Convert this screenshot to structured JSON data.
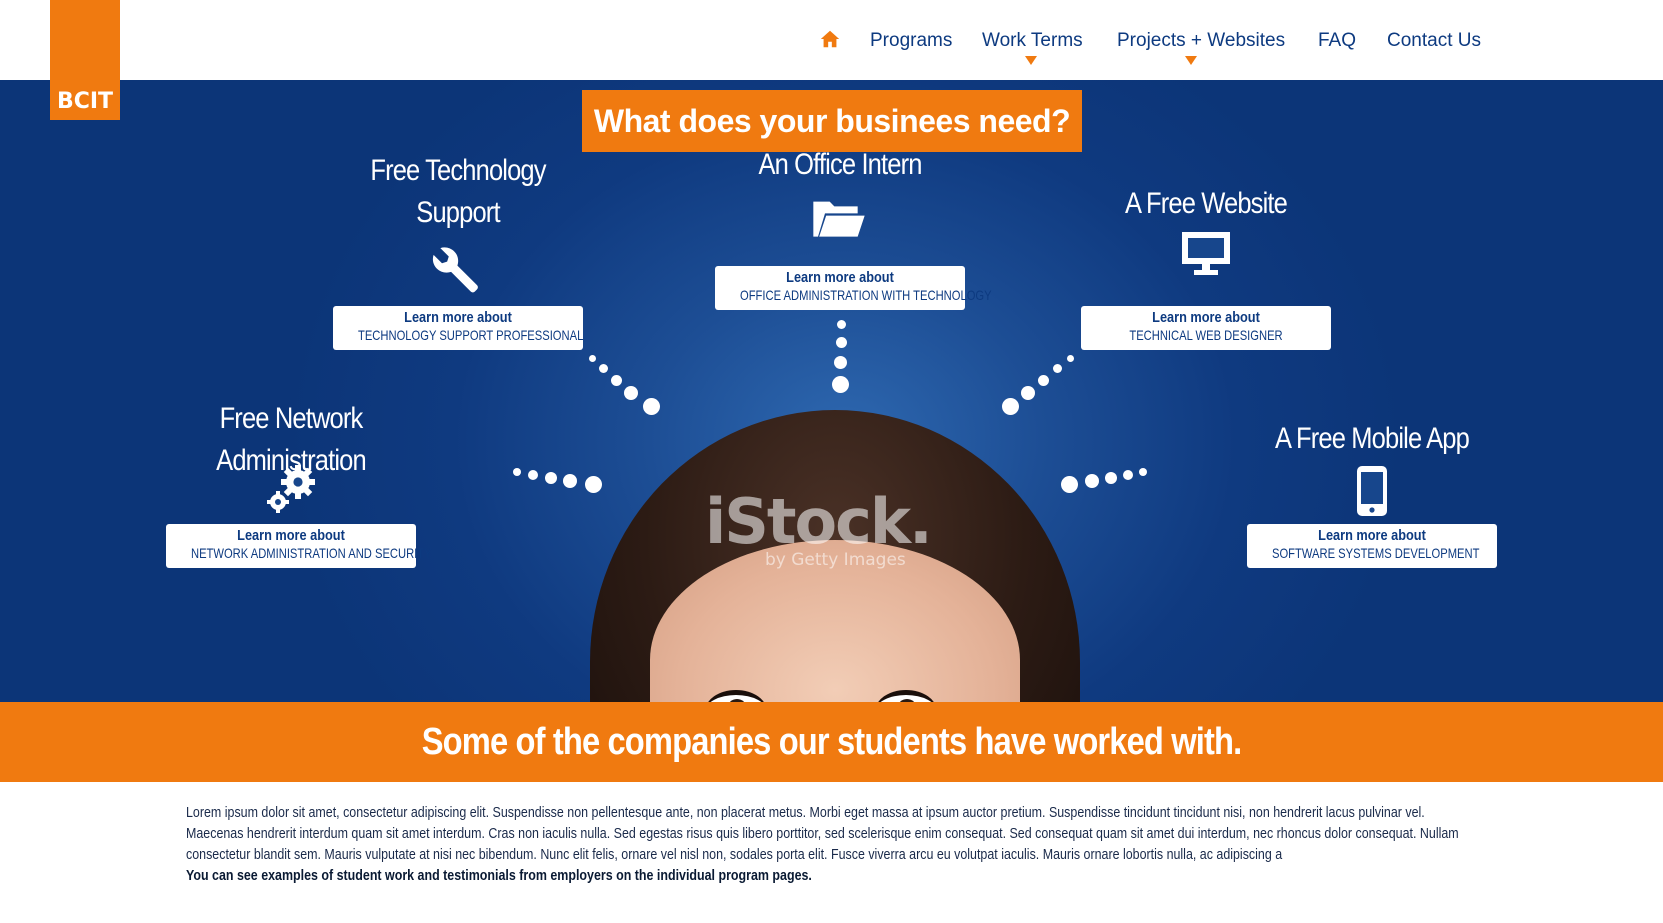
{
  "logo": {
    "text": "BCIT"
  },
  "nav": {
    "home_icon": "home-icon",
    "items": [
      "Programs",
      "Work Terms",
      "Projects + Websites",
      "FAQ",
      "Contact Us"
    ]
  },
  "hero": {
    "title": "What does your businees need?",
    "services": [
      {
        "title": "Free Technology Support",
        "icon": "wrench-icon",
        "btn_l1": "Learn more about",
        "btn_l2": "TECHNOLOGY SUPPORT PROFESSIONAL"
      },
      {
        "title": "An Office Intern",
        "icon": "folder-icon",
        "btn_l1": "Learn more about",
        "btn_l2": "OFFICE ADMINISTRATION WITH TECHNOLOGY"
      },
      {
        "title": "A Free Website",
        "icon": "monitor-icon",
        "btn_l1": "Learn more about",
        "btn_l2": "TECHNICAL WEB DESIGNER"
      },
      {
        "title": "Free Network Administration",
        "icon": "gears-icon",
        "btn_l1": "Learn more about",
        "btn_l2": "NETWORK ADMINISTRATION AND SECURITY"
      },
      {
        "title": "A Free Mobile App",
        "icon": "smartphone-icon",
        "btn_l1": "Learn more about",
        "btn_l2": "SOFTWARE SYSTEMS DEVELOPMENT"
      }
    ],
    "watermark": "iStock.",
    "watermark_sub": "by Getty Images"
  },
  "band": {
    "text": "Some of the companies our students have worked with."
  },
  "body": {
    "lorem": "Lorem ipsum dolor sit amet, consectetur adipiscing elit. Suspendisse non pellentesque ante, non placerat metus. Morbi eget massa at ipsum auctor pretium. Suspendisse tincidunt tincidunt nisi, non hendrerit lacus pulvinar vel. Maecenas hendrerit interdum quam sit amet interdum. Cras non iaculis nulla. Sed egestas risus quis libero porttitor, sed scelerisque enim consequat. Sed consequat quam sit amet dui interdum, nec rhoncus dolor consequat. Nullam consectetur blandit sem. Mauris vulputate at nisi nec bibendum. Nunc elit felis, ornare vel nisl non, sodales porta elit. Fusce viverra arcu eu volutpat iaculis. Mauris ornare lobortis nulla, ac adipiscing a",
    "strong": "You can see examples of student work and testimonials from employers on the individual program pages."
  },
  "colors": {
    "orange": "#f07a10",
    "navy": "#0d3a80",
    "hero_blue": "#0f3a80"
  }
}
